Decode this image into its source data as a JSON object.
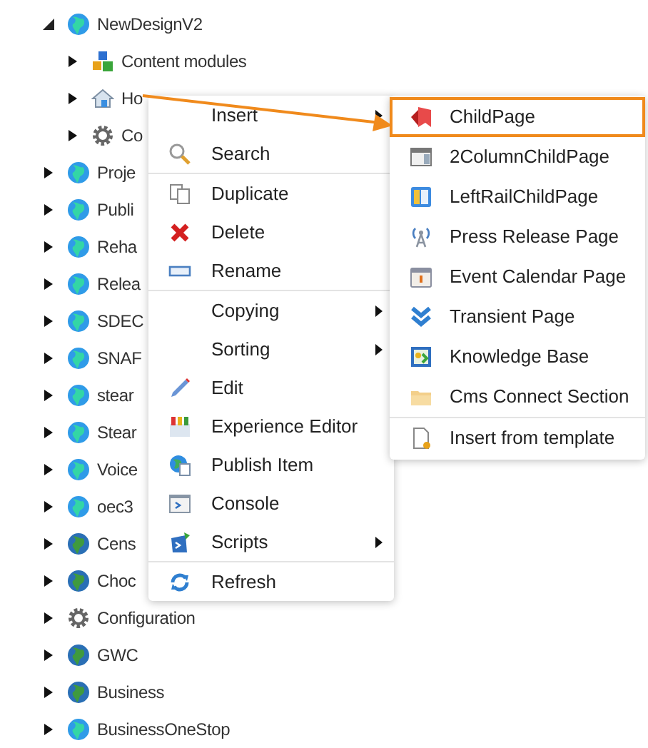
{
  "tree": [
    {
      "label": "NewDesignV2",
      "kind": "globe",
      "expanded": true,
      "children": [
        {
          "label": "Content modules",
          "kind": "modules",
          "expanded": false
        },
        {
          "label": "Ho",
          "kind": "home",
          "expanded": false
        },
        {
          "label": "Co",
          "kind": "gear",
          "expanded": false
        }
      ]
    },
    {
      "label": "Proje",
      "kind": "globe",
      "expanded": false
    },
    {
      "label": "Publi",
      "kind": "globe",
      "expanded": false
    },
    {
      "label": "Reha",
      "kind": "globe",
      "expanded": false
    },
    {
      "label": "Relea",
      "kind": "globe",
      "expanded": false
    },
    {
      "label": "SDEC",
      "kind": "globe",
      "expanded": false
    },
    {
      "label": "SNAF",
      "kind": "globe",
      "expanded": false
    },
    {
      "label": "stear",
      "kind": "globe",
      "expanded": false
    },
    {
      "label": "Stear",
      "kind": "globe",
      "expanded": false
    },
    {
      "label": "Voice",
      "kind": "globe",
      "expanded": false
    },
    {
      "label": "oec3",
      "kind": "globe",
      "expanded": false
    },
    {
      "label": "Cens",
      "kind": "globe-dark",
      "expanded": false
    },
    {
      "label": "Choc",
      "kind": "globe-dark",
      "expanded": false
    },
    {
      "label": "Configuration",
      "kind": "gear",
      "expanded": false
    },
    {
      "label": "GWC",
      "kind": "globe-dark",
      "expanded": false
    },
    {
      "label": "Business",
      "kind": "globe-dark",
      "expanded": false
    },
    {
      "label": "BusinessOneStop",
      "kind": "globe",
      "expanded": false
    }
  ],
  "context_menu": {
    "groups": [
      [
        {
          "label": "Insert",
          "kind": "none",
          "submenu": true
        },
        {
          "label": "Search",
          "kind": "search",
          "submenu": false
        }
      ],
      [
        {
          "label": "Duplicate",
          "kind": "duplicate",
          "submenu": false
        },
        {
          "label": "Delete",
          "kind": "delete",
          "submenu": false
        },
        {
          "label": "Rename",
          "kind": "rename",
          "submenu": false
        }
      ],
      [
        {
          "label": "Copying",
          "kind": "none",
          "submenu": true
        },
        {
          "label": "Sorting",
          "kind": "none",
          "submenu": true
        },
        {
          "label": "Edit",
          "kind": "edit",
          "submenu": false
        },
        {
          "label": "Experience Editor",
          "kind": "crayons",
          "submenu": false
        },
        {
          "label": "Publish Item",
          "kind": "publish",
          "submenu": false
        },
        {
          "label": "Console",
          "kind": "console",
          "submenu": false
        },
        {
          "label": "Scripts",
          "kind": "scripts",
          "submenu": true
        }
      ],
      [
        {
          "label": "Refresh",
          "kind": "refresh",
          "submenu": false
        }
      ]
    ]
  },
  "insert_submenu": {
    "groups": [
      [
        {
          "label": "ChildPage",
          "kind": "childpage",
          "selected": true
        },
        {
          "label": "2ColumnChildPage",
          "kind": "two-column",
          "selected": false
        },
        {
          "label": "LeftRailChildPage",
          "kind": "left-rail",
          "selected": false
        },
        {
          "label": "Press Release Page",
          "kind": "antenna",
          "selected": false
        },
        {
          "label": "Event Calendar Page",
          "kind": "calendar",
          "selected": false
        },
        {
          "label": "Transient Page",
          "kind": "chevrons",
          "selected": false
        },
        {
          "label": "Knowledge Base",
          "kind": "knowledge",
          "selected": false
        },
        {
          "label": "Cms Connect Section",
          "kind": "folder",
          "selected": false
        }
      ],
      [
        {
          "label": "Insert from template",
          "kind": "template",
          "selected": false
        }
      ]
    ]
  }
}
